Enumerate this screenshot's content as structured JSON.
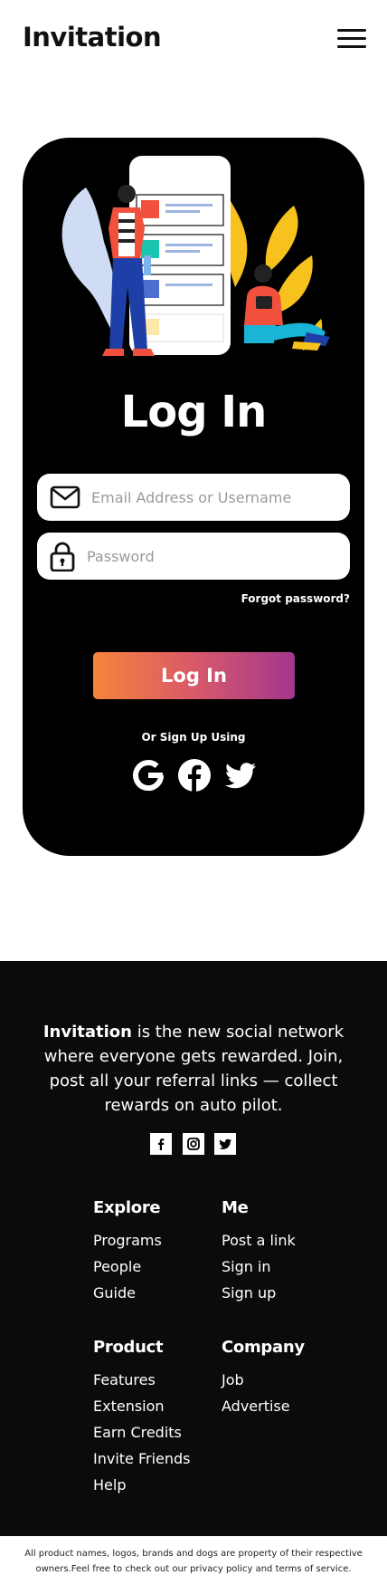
{
  "header": {
    "brand": "Invitation",
    "menu_icon": "hamburger-menu-icon"
  },
  "login": {
    "title": "Log In",
    "email_placeholder": "Email Address or Username",
    "email_icon": "envelope-icon",
    "password_placeholder": "Password",
    "password_icon": "lock-icon",
    "forgot_label": "Forgot password?",
    "submit_label": "Log In",
    "or_text": "Or Sign Up Using",
    "social": [
      "google-icon",
      "facebook-icon",
      "twitter-icon"
    ],
    "button_gradient": [
      "#f5843b",
      "#a2378e"
    ]
  },
  "footer": {
    "tagline_brand": "Invitation",
    "tagline_rest": " is the new social network where everyone gets rewarded. Join, post all your referral links — collect rewards on auto pilot.",
    "social": [
      "facebook-icon",
      "instagram-icon",
      "twitter-icon"
    ],
    "columns": [
      {
        "title": "Explore",
        "links": [
          "Programs",
          "People",
          "Guide"
        ]
      },
      {
        "title": "Me",
        "links": [
          "Post a link",
          "Sign in",
          "Sign up"
        ]
      },
      {
        "title": "Product",
        "links": [
          "Features",
          "Extension",
          "Earn Credits",
          "Invite Friends",
          "Help"
        ]
      },
      {
        "title": "Company",
        "links": [
          "Job",
          "Advertise"
        ]
      }
    ],
    "copyright": "All product names, logos, brands and dogs are property of their respective owners.Feel free to check out our privacy policy and terms of service."
  },
  "colors": {
    "card_bg": "#000000",
    "footer_bg": "#0b0b0b",
    "accent_yellow": "#f7c21d",
    "accent_red": "#f0503c",
    "accent_blue": "#1f3fa8"
  }
}
